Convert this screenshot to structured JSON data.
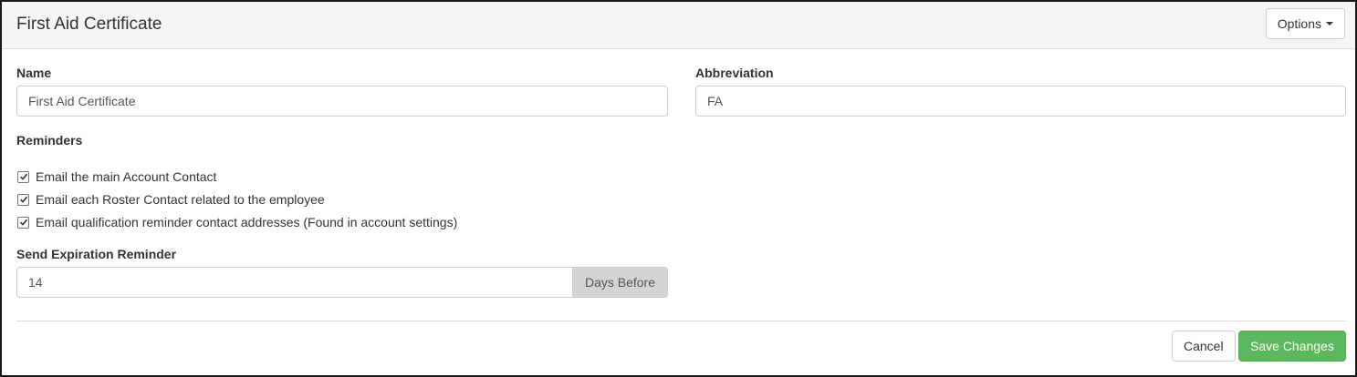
{
  "header": {
    "title": "First Aid Certificate",
    "options_label": "Options"
  },
  "form": {
    "name_label": "Name",
    "name_value": "First Aid Certificate",
    "abbreviation_label": "Abbreviation",
    "abbreviation_value": "FA",
    "reminders_label": "Reminders",
    "reminders": [
      {
        "label": "Email the main Account Contact",
        "checked": true
      },
      {
        "label": "Email each Roster Contact related to the employee",
        "checked": true
      },
      {
        "label": "Email qualification reminder contact addresses (Found in account settings)",
        "checked": true
      }
    ],
    "expiration_label": "Send Expiration Reminder",
    "expiration_value": "14",
    "expiration_addon": "Days Before"
  },
  "footer": {
    "cancel_label": "Cancel",
    "save_label": "Save Changes"
  },
  "colors": {
    "save_button": "#5cb85c",
    "heading_bg": "#f5f5f5",
    "addon_bg": "#d4d4d4"
  }
}
